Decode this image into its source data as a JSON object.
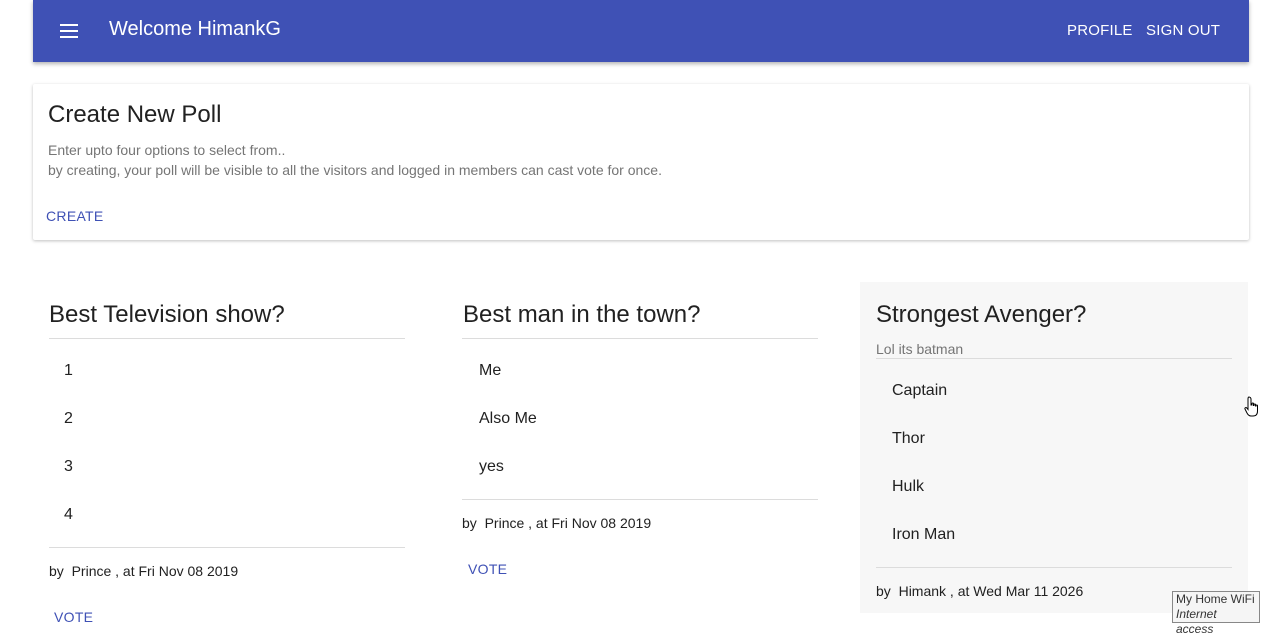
{
  "appbar": {
    "title": "Welcome HimankG",
    "profile_label": "PROFILE",
    "signout_label": "SIGN OUT",
    "color": "#3f51b5"
  },
  "create_card": {
    "title": "Create New Poll",
    "line1": "Enter upto four options to select from..",
    "line2": "by creating, your poll will be visible to all the visitors and logged in members can cast vote for once.",
    "create_label": "CREATE"
  },
  "polls": [
    {
      "title": "Best Television show?",
      "options": [
        "1",
        "2",
        "3",
        "4"
      ],
      "by_label": "by",
      "author_date": "Prince , at Fri Nov 08 2019",
      "vote_label": "VOTE"
    },
    {
      "title": "Best man in the town?",
      "options": [
        "Me",
        "Also Me",
        "yes"
      ],
      "by_label": "by",
      "author_date": "Prince , at Fri Nov 08 2019",
      "vote_label": "VOTE"
    },
    {
      "title": "Strongest Avenger?",
      "subtitle": "Lol its batman",
      "options": [
        "Captain",
        "Thor",
        "Hulk",
        "Iron Man"
      ],
      "by_label": "by",
      "author_date": "Himank , at Wed Mar 11 2026"
    }
  ],
  "tooltip": {
    "line1": "My Home WiFi",
    "line2": "Internet access"
  }
}
